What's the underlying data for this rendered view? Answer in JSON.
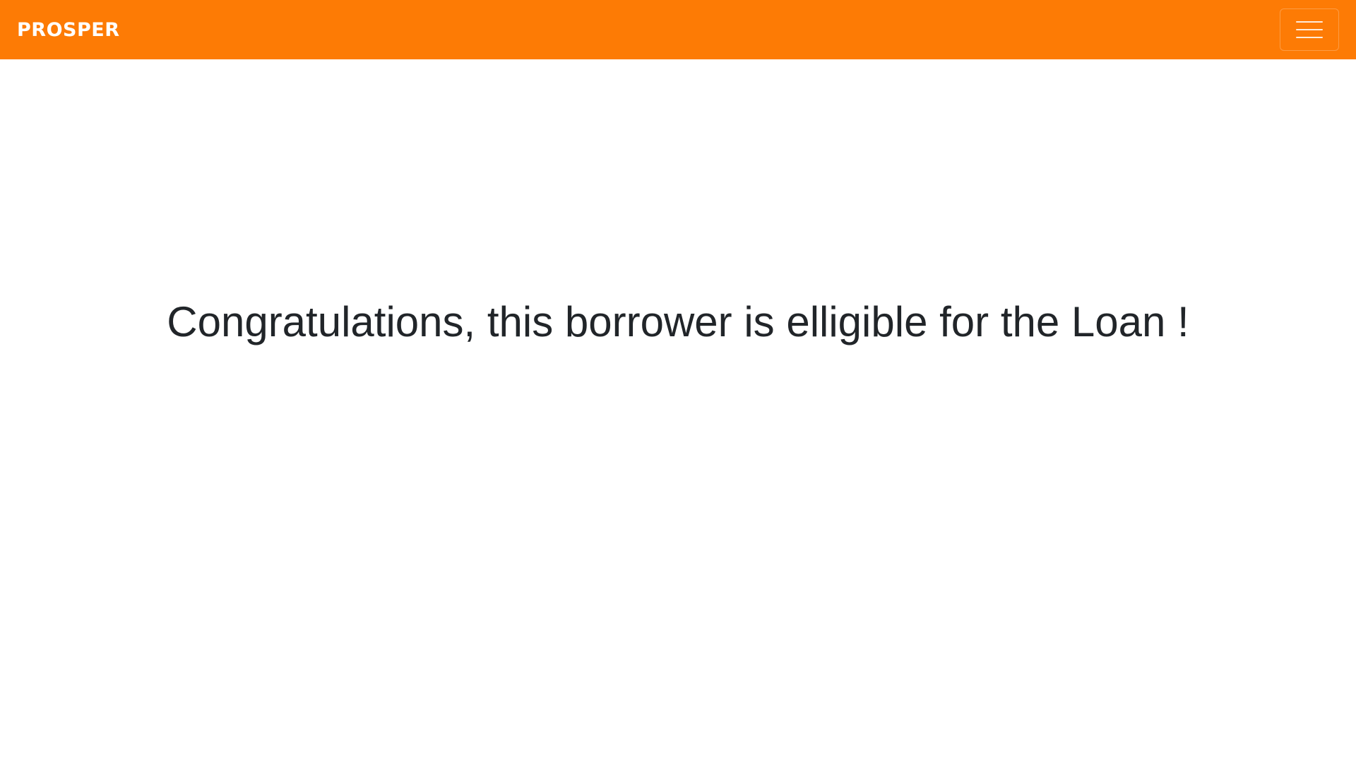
{
  "navbar": {
    "brand": "PROSPER",
    "toggler_icon": "hamburger-menu-icon",
    "background_color": "#fd7b05"
  },
  "main": {
    "message": "Congratulations, this borrower is elligible for the Loan !"
  }
}
